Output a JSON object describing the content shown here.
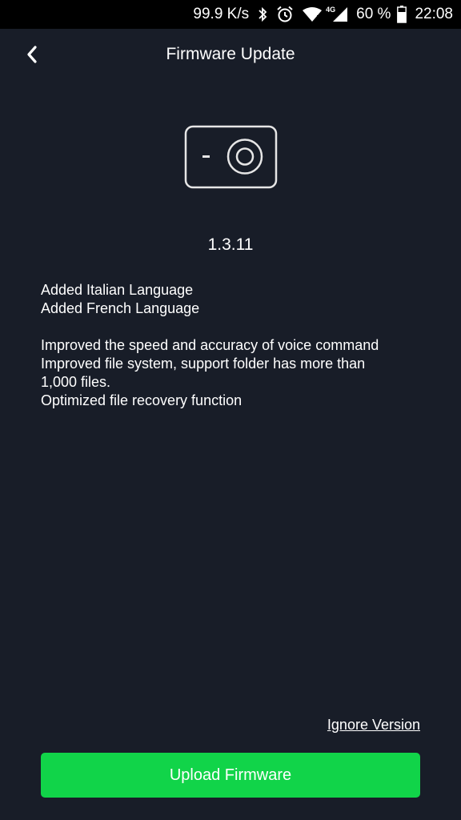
{
  "status_bar": {
    "net_speed": "99.9 K/s",
    "network_type": "4G",
    "battery_percent": "60 %",
    "time": "22:08",
    "icons": [
      "bluetooth-icon",
      "alarm-icon",
      "wifi-icon",
      "signal-icon",
      "battery-icon"
    ]
  },
  "header": {
    "title": "Firmware Update",
    "back_icon": "chevron-left-icon"
  },
  "device": {
    "icon": "camera-icon",
    "version": "1.3.11"
  },
  "release_notes": {
    "group1": [
      "Added Italian Language",
      "Added French Language"
    ],
    "group2": [
      "Improved the speed and accuracy of voice command",
      "Improved file system, support folder has more than",
      "1,000 files.",
      "Optimized file recovery function"
    ]
  },
  "actions": {
    "ignore_label": "Ignore Version",
    "upload_label": "Upload Firmware",
    "upload_color": "#11d449"
  },
  "colors": {
    "background": "#181d28",
    "status_bar": "#000000",
    "text": "#ffffff"
  }
}
